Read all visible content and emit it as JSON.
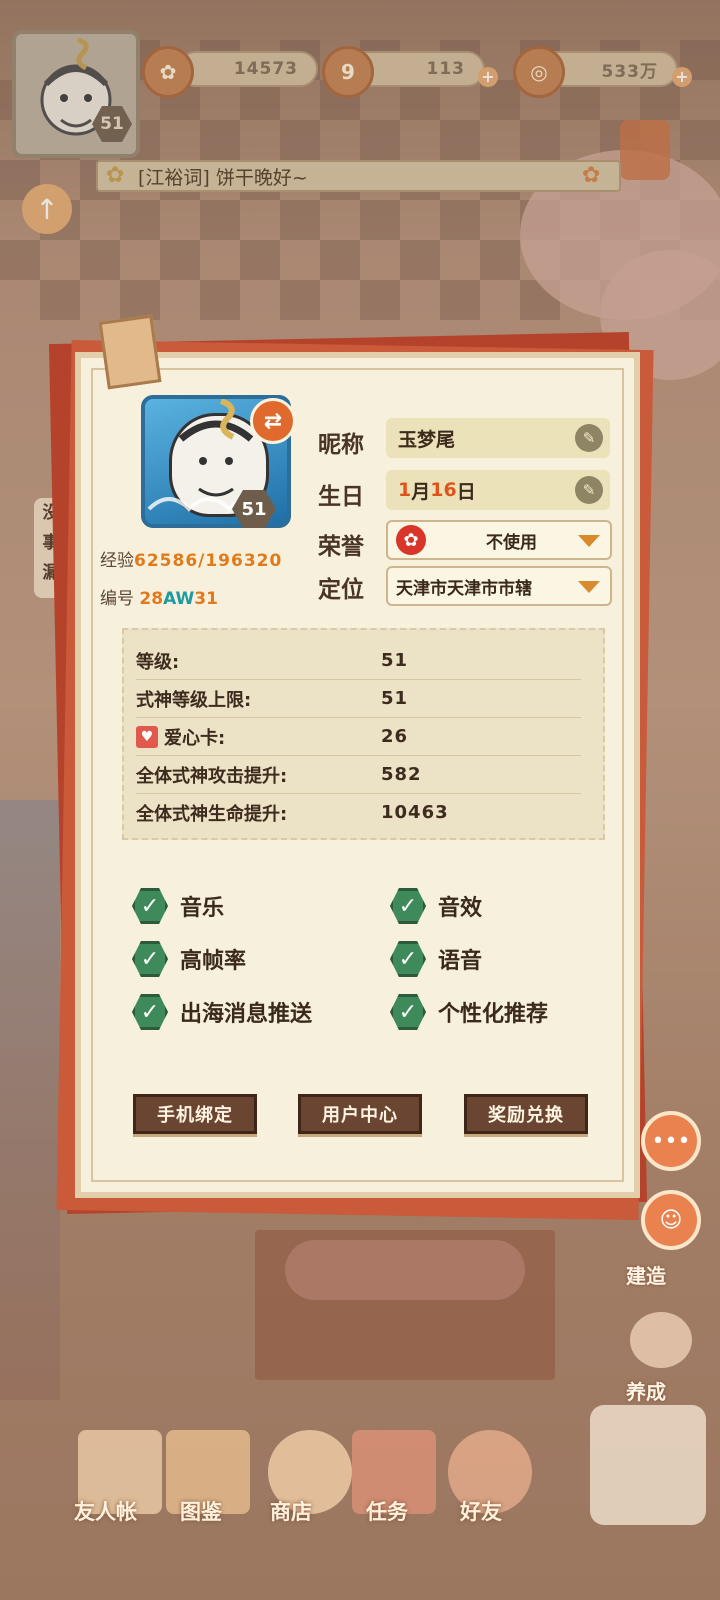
{
  "top_bar": {
    "player_level": "51",
    "jade": "14573",
    "stamina": "113",
    "gold": "533万"
  },
  "chat_banner": {
    "text": "[江裕词] 饼干晚好~"
  },
  "left_hint": {
    "text": "没\n事\n漏"
  },
  "profile": {
    "avatar_level": "51",
    "exp_label": "经验",
    "exp_value": "62586/196320",
    "id_label": "编号",
    "id_part1": "28",
    "id_part2": "AW",
    "id_part3": "31",
    "nickname_label": "昵称",
    "nickname": "玉梦尾",
    "birthday_label": "生日",
    "birthday_month": "1",
    "birthday_month_unit": "月",
    "birthday_day": "16",
    "birthday_day_unit": "日",
    "honor_label": "荣誉",
    "honor_value": "不使用",
    "location_label": "定位",
    "location_value": "天津市天津市市辖"
  },
  "stats": [
    {
      "label": "等级:",
      "value": "51"
    },
    {
      "label": "式神等级上限:",
      "value": "51"
    },
    {
      "label": "爱心卡:",
      "value": "26"
    },
    {
      "label": "全体式神攻击提升:",
      "value": "582"
    },
    {
      "label": "全体式神生命提升:",
      "value": "10463"
    }
  ],
  "options": [
    {
      "label": "音乐",
      "checked": true
    },
    {
      "label": "音效",
      "checked": true
    },
    {
      "label": "高帧率",
      "checked": true
    },
    {
      "label": "语音",
      "checked": true
    },
    {
      "label": "出海消息推送",
      "checked": true
    },
    {
      "label": "个性化推荐",
      "checked": true
    }
  ],
  "buttons": {
    "phone_bind": "手机绑定",
    "user_center": "用户中心",
    "reward_redeem": "奖励兑换"
  },
  "side": {
    "build": "建造",
    "nurture": "养成"
  },
  "bottom_nav": [
    {
      "label": "友人帐"
    },
    {
      "label": "图鉴"
    },
    {
      "label": "商店"
    },
    {
      "label": "任务"
    },
    {
      "label": "好友"
    }
  ],
  "colors": {
    "card_bg": "#f7f0dc",
    "card_frame": "#b5432c",
    "check_green": "#3e8a5a",
    "accent_orange": "#e07b1c",
    "accent_teal": "#1e9aa0"
  }
}
